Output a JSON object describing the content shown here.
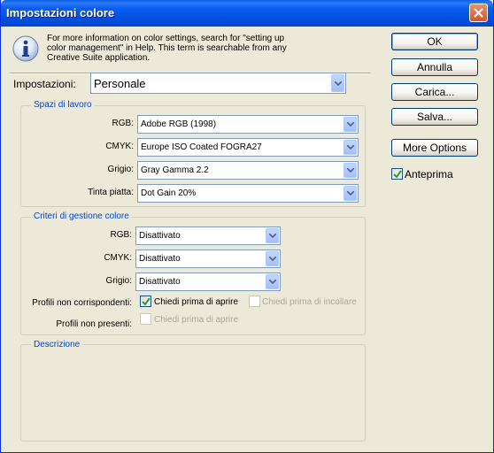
{
  "window": {
    "title": "Impostazioni colore"
  },
  "info": {
    "text_line1": "For more information on color settings, search for \"setting up",
    "text_line2": "color management\" in Help. This term is searchable from any",
    "text_line3": "Creative Suite application."
  },
  "settings": {
    "label": "Impostazioni:",
    "value": "Personale"
  },
  "working_spaces": {
    "title": "Spazi di lavoro",
    "rgb": {
      "label": "RGB:",
      "value": "Adobe RGB (1998)"
    },
    "cmyk": {
      "label": "CMYK:",
      "value": "Europe ISO Coated FOGRA27"
    },
    "gray": {
      "label": "Grigio:",
      "value": "Gray Gamma 2.2"
    },
    "spot": {
      "label": "Tinta piatta:",
      "value": "Dot Gain 20%"
    }
  },
  "policies": {
    "title": "Criteri di gestione colore",
    "rgb": {
      "label": "RGB:",
      "value": "Disattivato"
    },
    "cmyk": {
      "label": "CMYK:",
      "value": "Disattivato"
    },
    "gray": {
      "label": "Grigio:",
      "value": "Disattivato"
    },
    "mismatch_label": "Profili non corrispondenti:",
    "mismatch_open": {
      "label": "Chiedi prima di aprire",
      "checked": true
    },
    "mismatch_paste": {
      "label": "Chiedi prima di incollare",
      "checked": false
    },
    "missing_label": "Profili non presenti:",
    "missing_open": {
      "label": "Chiedi prima di aprire",
      "checked": false
    }
  },
  "description": {
    "title": "Descrizione"
  },
  "buttons": {
    "ok": "OK",
    "cancel": "Annulla",
    "load": "Carica...",
    "save": "Salva...",
    "more_options": "More Options"
  },
  "preview": {
    "label": "Anteprima",
    "checked": true
  },
  "colors": {
    "titlebar": "#0553e1",
    "group_title": "#0046d5",
    "face": "#ece9d8"
  }
}
